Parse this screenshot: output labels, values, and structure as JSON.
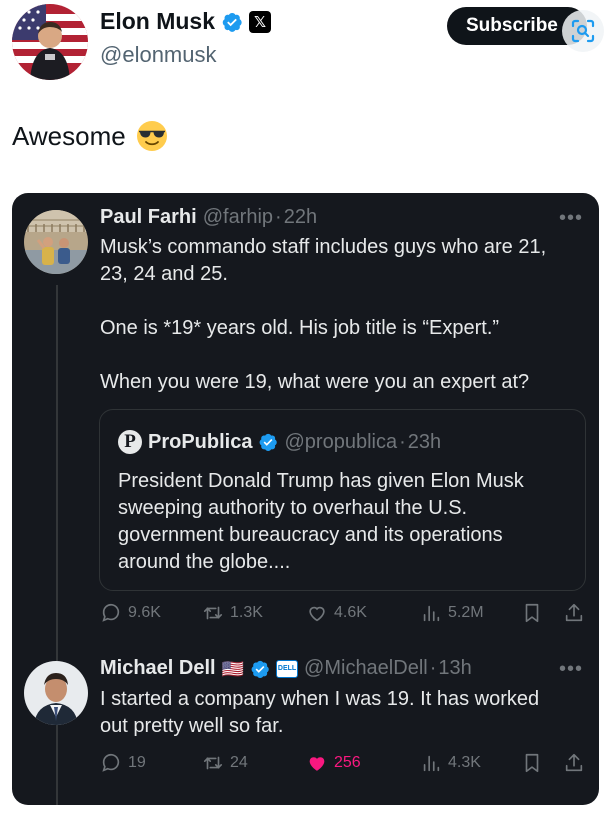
{
  "author": {
    "name": "Elon Musk",
    "handle": "@elonmusk",
    "x_badge": "𝕏"
  },
  "subscribe_label": "Subscribe",
  "post": {
    "text": "Awesome",
    "emoji_icon": "sunglasses-emoji-icon"
  },
  "quoted_thread": {
    "tweet1": {
      "name": "Paul Farhi",
      "handle": "@farhip",
      "sep": "·",
      "time": "22h",
      "more": "•••",
      "line1": "Musk’s commando staff includes guys who are 21,",
      "line2": "23, 24 and 25.",
      "line3": "One is *19* years old. His job title is “Expert.”",
      "line4": "When you were 19, what were you an expert at?",
      "quote": {
        "logo": "P",
        "name": "ProPublica",
        "handle": "@propublica",
        "sep": "·",
        "time": "23h",
        "line1": "President Donald Trump has given Elon Musk",
        "line2": "sweeping authority to overhaul the U.S.",
        "line3": "government bureaucracy and its operations",
        "line4": "around the globe...."
      },
      "stats": {
        "replies": "9.6K",
        "reposts": "1.3K",
        "likes": "4.6K",
        "views": "5.2M"
      }
    },
    "tweet2": {
      "name": "Michael Dell",
      "flag": "🇺🇸",
      "dell_logo": "DELL",
      "handle": "@MichaelDell",
      "sep": "·",
      "time": "13h",
      "more": "•••",
      "line1": "I started a company when I was 19. It has worked",
      "line2": "out pretty well so far.",
      "stats": {
        "replies": "19",
        "reposts": "24",
        "likes": "256",
        "views": "4.3K"
      }
    }
  },
  "colors": {
    "verified_blue": "#1d9bf0",
    "like_pink": "#f91880",
    "card_bg": "#15181e"
  }
}
